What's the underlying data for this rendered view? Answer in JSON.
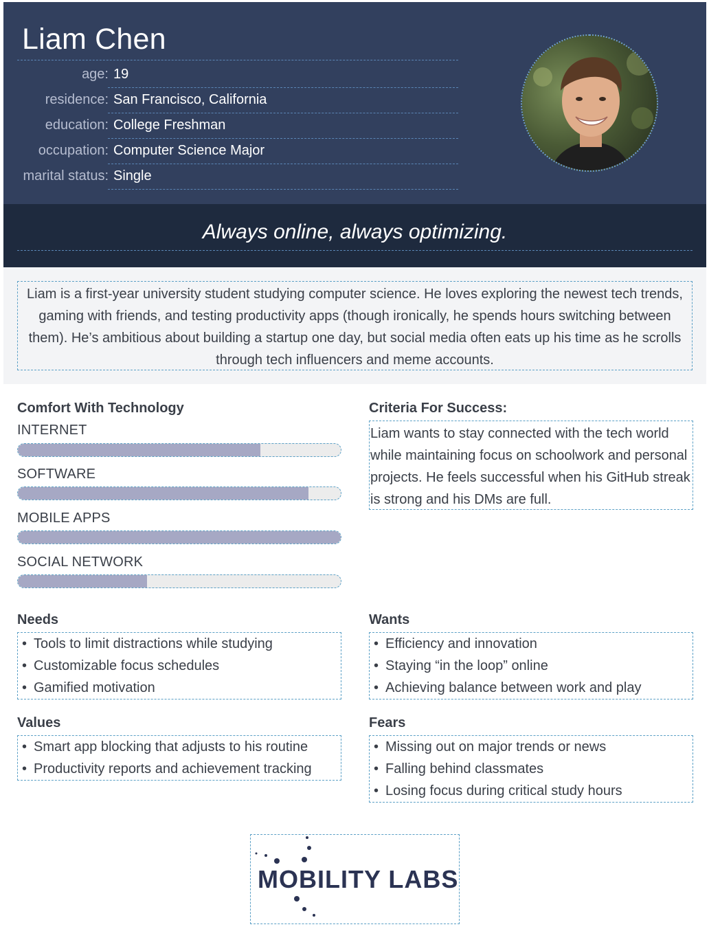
{
  "persona": {
    "name": "Liam Chen",
    "attributes": [
      {
        "label": "age:",
        "value": "19"
      },
      {
        "label": "residence:",
        "value": "San Francisco, California"
      },
      {
        "label": "education:",
        "value": "College Freshman"
      },
      {
        "label": "occupation:",
        "value": "Computer Science Major"
      },
      {
        "label": "marital status:",
        "value": "Single"
      }
    ],
    "quote": "Always online, always optimizing.",
    "bio": "Liam is a first-year university student studying computer science. He loves exploring the newest tech trends, gaming with friends, and testing productivity apps (though ironically, he spends hours switching between them). He’s ambitious about building a startup one day, but social media often eats up his time as he scrolls through tech influencers and meme accounts."
  },
  "comfort": {
    "title": "Comfort With Technology",
    "skills": [
      {
        "label": "INTERNET",
        "level": 0.75
      },
      {
        "label": "SOFTWARE",
        "level": 0.9
      },
      {
        "label": "MOBILE APPS",
        "level": 1.0
      },
      {
        "label": "SOCIAL NETWORK",
        "level": 0.4
      }
    ]
  },
  "criteria": {
    "title": "Criteria For Success:",
    "text": "Liam wants to stay connected with the tech world while maintaining focus on schoolwork and personal projects. He feels successful when his GitHub streak is strong and his DMs are full."
  },
  "needs": {
    "title": "Needs",
    "items": [
      "Tools to limit distractions while studying",
      "Customizable focus schedules",
      "Gamified motivation"
    ]
  },
  "wants": {
    "title": "Wants",
    "items": [
      "Efficiency and innovation",
      "Staying “in the loop” online",
      "Achieving balance between work and play"
    ]
  },
  "values": {
    "title": "Values",
    "items": [
      "Smart app blocking that adjusts to his routine",
      "Productivity reports and achievement tracking"
    ]
  },
  "fears": {
    "title": "Fears",
    "items": [
      "Missing out on major trends or news",
      "Falling behind classmates",
      "Losing focus during critical study hours"
    ]
  },
  "logo": {
    "text": "MOBILITY LABS",
    "color": "#2b3353"
  },
  "colors": {
    "header_bg": "#32405e",
    "quote_bg": "#1e2a3e",
    "bar_fill": "#a6a8c4",
    "dashed_border": "#5ba0c6"
  }
}
